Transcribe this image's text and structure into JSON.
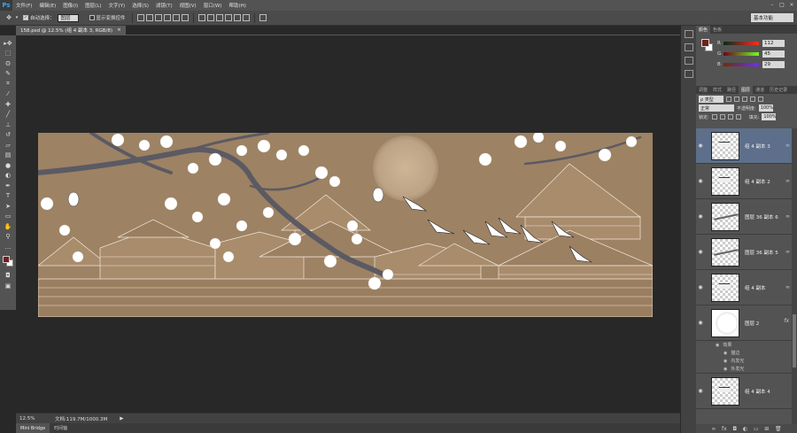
{
  "app": {
    "logo": "Ps"
  },
  "menu": [
    "文件(F)",
    "编辑(E)",
    "图像(I)",
    "图层(L)",
    "文字(Y)",
    "选择(S)",
    "滤镜(T)",
    "视图(V)",
    "窗口(W)",
    "帮助(H)"
  ],
  "options": {
    "auto_select_label": "自动选择：",
    "auto_select_value": "图层",
    "transform_label": "显示变换控件",
    "workspace": "基本功能"
  },
  "document": {
    "tab_title": "158.psd @ 12.5% (组 4 副本 3, RGB/8)",
    "tab_close": "×"
  },
  "status": {
    "zoom": "12.5%",
    "doc_info": "文档:119.7M/1000.3M",
    "arrow": "▶"
  },
  "bottom_tabs": [
    "Mini Bridge",
    "时间轴"
  ],
  "color_panel": {
    "tabs": [
      "颜色",
      "色板"
    ],
    "r_label": "R",
    "g_label": "G",
    "b_label": "B",
    "r": "112",
    "g": "45",
    "b": "29",
    "fg_color": "#70201d"
  },
  "layers_panel": {
    "tabs": [
      "调整",
      "样式",
      "路径",
      "图层",
      "通道",
      "历史记录"
    ],
    "kind_filter": "ρ 类型",
    "blend_mode": "正常",
    "opacity_label": "不透明度:",
    "opacity": "100%",
    "lock_label": "锁定:",
    "fill_label": "填充:",
    "fill": "100%",
    "layers": [
      {
        "name": "组 4 副本 3",
        "selected": true,
        "thumb": "bird"
      },
      {
        "name": "组 4 副本 2",
        "selected": false,
        "thumb": "bird"
      },
      {
        "name": "图层 36 副本 6",
        "selected": false,
        "thumb": "branch"
      },
      {
        "name": "图层 36 副本 5",
        "selected": false,
        "thumb": "branch"
      },
      {
        "name": "组 4 副本",
        "selected": false,
        "thumb": "bird"
      },
      {
        "name": "图层 2",
        "selected": false,
        "thumb": "ball"
      }
    ],
    "effects": {
      "title": "效果",
      "items": [
        "描边",
        "内发光",
        "外发光"
      ]
    },
    "last_layer": "组 4 副本 4"
  }
}
